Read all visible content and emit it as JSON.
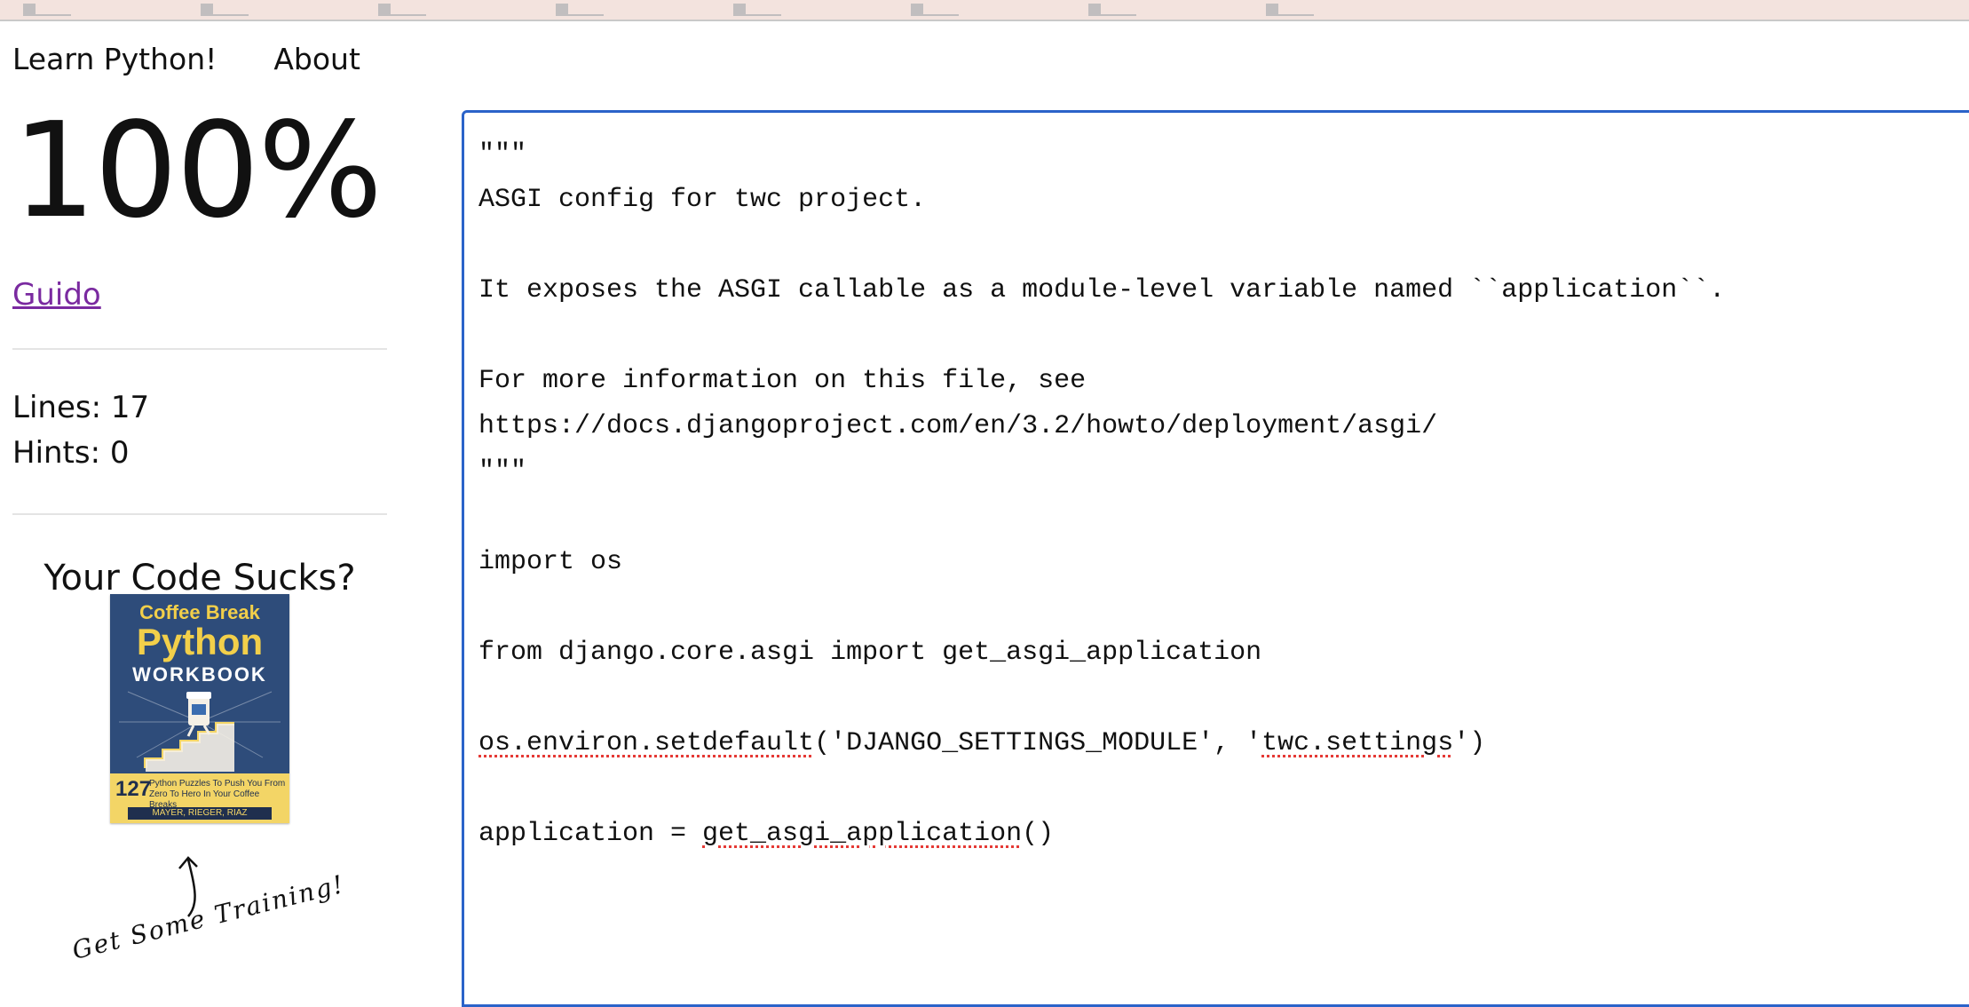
{
  "nav": {
    "brand": "Learn Python!",
    "about": "About"
  },
  "sidebar": {
    "score": "100%",
    "user": "Guido",
    "lines": "Lines: 17",
    "hints": "Hints: 0",
    "promo_title": "Your Code Sucks?",
    "training_text": "Get Some Training!"
  },
  "book": {
    "line1": "Coffee Break",
    "line2": "Python",
    "line3": "WORKBOOK",
    "number": "127",
    "subtitle": "Python Puzzles To Push You From Zero To Hero In Your Coffee Breaks",
    "authors": "MAYER, RIEGER, RIAZ"
  },
  "editor": {
    "lines": [
      "\"\"\"",
      "ASGI config for twc project.",
      "",
      "It exposes the ASGI callable as a module-level variable named ``application``.",
      "",
      "For more information on this file, see",
      "https://docs.djangoproject.com/en/3.2/howto/deployment/asgi/",
      "\"\"\"",
      "",
      "import os",
      "",
      "from django.core.asgi import get_asgi_application",
      "",
      "os.environ.setdefault('DJANGO_SETTINGS_MODULE', 'twc.settings')",
      "",
      "application = get_asgi_application()"
    ]
  },
  "colors": {
    "link": "#7a2aa0",
    "editor_border": "#2b63c9",
    "spell_underline": "#e53935",
    "book_blue": "#2e4c7a",
    "book_yellow": "#f3d566"
  }
}
